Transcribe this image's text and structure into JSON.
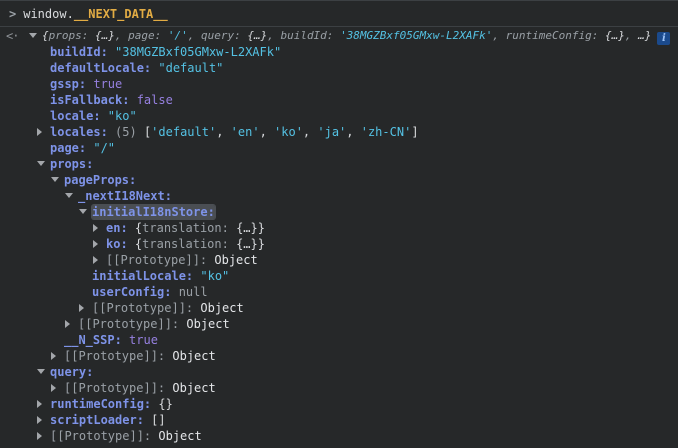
{
  "colors": {
    "background": "#262829",
    "border": "#3c4043",
    "key": "#7e93e8",
    "string": "#54c2e4",
    "boolean": "#9680e0",
    "muted": "#9aa0a6",
    "plain": "#d9dbde",
    "objw": "#e4e6e9",
    "gold": "#e2ac44",
    "prompt": "#9aa0a6",
    "highlight_bg": "#4a4e53",
    "info_bg": "#1b4a8c",
    "info_fg": "#9cc3f7"
  },
  "icons": {
    "prompt": ">",
    "returned_value": "<·",
    "info": "i"
  },
  "console": {
    "input": {
      "prompt": ">",
      "object_text": "window.",
      "property_text": "__NEXT_DATA__"
    },
    "rows": [
      {
        "name": "result-preview",
        "level": 0,
        "arrow": "open",
        "ret": true,
        "italic": true,
        "info": true,
        "parts": [
          [
            "plain",
            "{"
          ],
          [
            "muted",
            "props: "
          ],
          [
            "plain",
            "{…}"
          ],
          [
            "muted",
            ", page: "
          ],
          [
            "str",
            "'/'"
          ],
          [
            "muted",
            ", query: "
          ],
          [
            "plain",
            "{…}"
          ],
          [
            "muted",
            ", buildId: "
          ],
          [
            "str",
            "'38MGZBxf05GMxw-L2XAFk'"
          ],
          [
            "muted",
            ", runtimeConfig: "
          ],
          [
            "plain",
            "{…}"
          ],
          [
            "muted",
            ", "
          ],
          [
            "plain",
            "…}"
          ]
        ]
      },
      {
        "name": "row-buildId",
        "level": 1,
        "arrow": "none",
        "parts": [
          [
            "key",
            "buildId: "
          ],
          [
            "str",
            "\"38MGZBxf05GMxw-L2XAFk\""
          ]
        ]
      },
      {
        "name": "row-defaultLocale",
        "level": 1,
        "arrow": "none",
        "parts": [
          [
            "key",
            "defaultLocale: "
          ],
          [
            "str",
            "\"default\""
          ]
        ]
      },
      {
        "name": "row-gssp",
        "level": 1,
        "arrow": "none",
        "parts": [
          [
            "key",
            "gssp: "
          ],
          [
            "bool",
            "true"
          ]
        ]
      },
      {
        "name": "row-isFallback",
        "level": 1,
        "arrow": "none",
        "parts": [
          [
            "key",
            "isFallback: "
          ],
          [
            "bool",
            "false"
          ]
        ]
      },
      {
        "name": "row-locale",
        "level": 1,
        "arrow": "none",
        "parts": [
          [
            "key",
            "locale: "
          ],
          [
            "str",
            "\"ko\""
          ]
        ]
      },
      {
        "name": "row-locales",
        "level": 1,
        "arrow": "closed",
        "parts": [
          [
            "key",
            "locales: "
          ],
          [
            "muted",
            "(5) "
          ],
          [
            "plain",
            "["
          ],
          [
            "str",
            "'default'"
          ],
          [
            "plain",
            ", "
          ],
          [
            "str",
            "'en'"
          ],
          [
            "plain",
            ", "
          ],
          [
            "str",
            "'ko'"
          ],
          [
            "plain",
            ", "
          ],
          [
            "str",
            "'ja'"
          ],
          [
            "plain",
            ", "
          ],
          [
            "str",
            "'zh-CN'"
          ],
          [
            "plain",
            "]"
          ]
        ]
      },
      {
        "name": "row-page",
        "level": 1,
        "arrow": "none",
        "parts": [
          [
            "key",
            "page: "
          ],
          [
            "str",
            "\"/\""
          ]
        ]
      },
      {
        "name": "row-props",
        "level": 1,
        "arrow": "open",
        "parts": [
          [
            "key",
            "props:"
          ]
        ]
      },
      {
        "name": "row-pageProps",
        "level": 2,
        "arrow": "open",
        "parts": [
          [
            "key",
            "pageProps:"
          ]
        ]
      },
      {
        "name": "row-nextI18Next",
        "level": 3,
        "arrow": "open",
        "parts": [
          [
            "key",
            "_nextI18Next:"
          ]
        ]
      },
      {
        "name": "row-initialI18nStore",
        "level": 4,
        "arrow": "open",
        "parts": [
          [
            "key",
            "initialI18nStore:",
            "hl"
          ]
        ]
      },
      {
        "name": "row-en",
        "level": 5,
        "arrow": "closed",
        "parts": [
          [
            "key",
            "en: "
          ],
          [
            "plain",
            "{"
          ],
          [
            "muted",
            "translation: "
          ],
          [
            "plain",
            "{…}}"
          ]
        ]
      },
      {
        "name": "row-ko",
        "level": 5,
        "arrow": "closed",
        "parts": [
          [
            "key",
            "ko: "
          ],
          [
            "plain",
            "{"
          ],
          [
            "muted",
            "translation: "
          ],
          [
            "plain",
            "{…}}"
          ]
        ]
      },
      {
        "name": "row-prototype",
        "level": 5,
        "arrow": "closed",
        "parts": [
          [
            "muted",
            "[[Prototype]]: "
          ],
          [
            "objw",
            "Object"
          ]
        ]
      },
      {
        "name": "row-initialLocale",
        "level": 4,
        "arrow": "none",
        "parts": [
          [
            "key",
            "initialLocale: "
          ],
          [
            "str",
            "\"ko\""
          ]
        ]
      },
      {
        "name": "row-userConfig",
        "level": 4,
        "arrow": "none",
        "parts": [
          [
            "key",
            "userConfig: "
          ],
          [
            "muted",
            "null"
          ]
        ]
      },
      {
        "name": "row-prototype",
        "level": 4,
        "arrow": "closed",
        "parts": [
          [
            "muted",
            "[[Prototype]]: "
          ],
          [
            "objw",
            "Object"
          ]
        ]
      },
      {
        "name": "row-prototype",
        "level": 3,
        "arrow": "closed",
        "parts": [
          [
            "muted",
            "[[Prototype]]: "
          ],
          [
            "objw",
            "Object"
          ]
        ]
      },
      {
        "name": "row-N-SSP",
        "level": 2,
        "arrow": "none",
        "parts": [
          [
            "key",
            "__N_SSP: "
          ],
          [
            "bool",
            "true"
          ]
        ]
      },
      {
        "name": "row-prototype",
        "level": 2,
        "arrow": "closed",
        "parts": [
          [
            "muted",
            "[[Prototype]]: "
          ],
          [
            "objw",
            "Object"
          ]
        ]
      },
      {
        "name": "row-query",
        "level": 1,
        "arrow": "open",
        "parts": [
          [
            "key",
            "query:"
          ]
        ]
      },
      {
        "name": "row-prototype",
        "level": 2,
        "arrow": "closed",
        "parts": [
          [
            "muted",
            "[[Prototype]]: "
          ],
          [
            "objw",
            "Object"
          ]
        ]
      },
      {
        "name": "row-runtimeConfig",
        "level": 1,
        "arrow": "closed",
        "parts": [
          [
            "key",
            "runtimeConfig: "
          ],
          [
            "plain",
            "{}"
          ]
        ]
      },
      {
        "name": "row-scriptLoader",
        "level": 1,
        "arrow": "closed",
        "parts": [
          [
            "key",
            "scriptLoader: "
          ],
          [
            "plain",
            "[]"
          ]
        ]
      },
      {
        "name": "row-prototype",
        "level": 1,
        "arrow": "closed",
        "parts": [
          [
            "muted",
            "[[Prototype]]: "
          ],
          [
            "objw",
            "Object"
          ]
        ]
      }
    ]
  }
}
